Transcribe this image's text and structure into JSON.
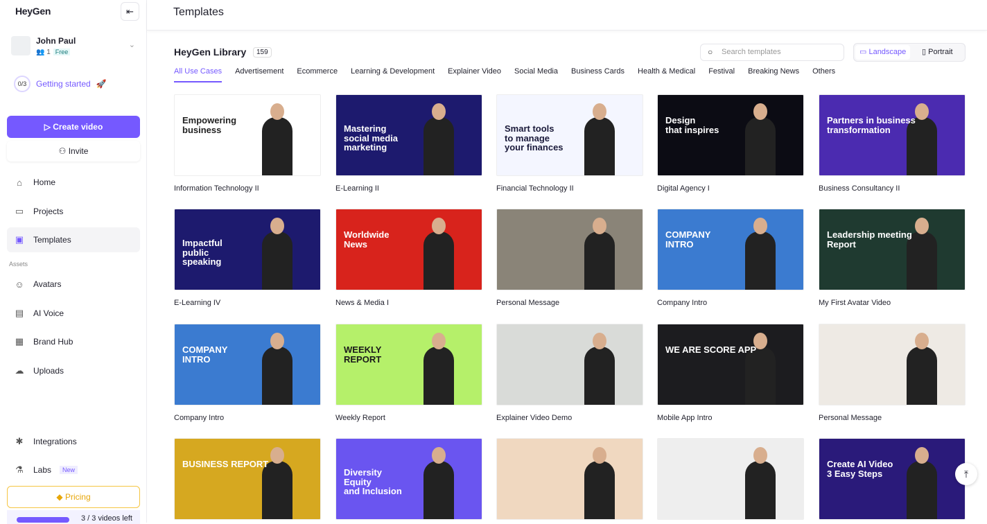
{
  "app": {
    "logo": "HeyGen",
    "page_title": "Templates"
  },
  "sidebar": {
    "user": {
      "name": "John Paul",
      "members": "1",
      "plan": "Free"
    },
    "getting_started": {
      "progress": "0/3",
      "label": "Getting started"
    },
    "create_video": "Create video",
    "invite": "Invite",
    "nav": [
      {
        "label": "Home",
        "icon": "home-icon"
      },
      {
        "label": "Projects",
        "icon": "folder-icon"
      },
      {
        "label": "Templates",
        "icon": "templates-icon",
        "active": true
      }
    ],
    "assets_label": "Assets",
    "assets": [
      {
        "label": "Avatars",
        "icon": "avatar-icon"
      },
      {
        "label": "AI Voice",
        "icon": "voice-icon"
      },
      {
        "label": "Brand Hub",
        "icon": "brand-icon"
      },
      {
        "label": "Uploads",
        "icon": "upload-icon"
      }
    ],
    "integrations": "Integrations",
    "labs": "Labs",
    "labs_badge": "New",
    "pricing": "Pricing",
    "quota": "3 / 3 videos left",
    "quota_fraction": 1.0
  },
  "library": {
    "title": "HeyGen Library",
    "count": "159",
    "search_placeholder": "Search templates",
    "landscape": "Landscape",
    "portrait": "Portrait",
    "tabs": [
      "All Use Cases",
      "Advertisement",
      "Ecommerce",
      "Learning & Development",
      "Explainer Video",
      "Social Media",
      "Business Cards",
      "Health & Medical",
      "Festival",
      "Breaking News",
      "Others"
    ],
    "templates": [
      {
        "name": "Information Technology II",
        "text": "Empowering\nbusiness",
        "bg": "#ffffff",
        "fg": "#222"
      },
      {
        "name": "E-Learning II",
        "text": "Mastering\nsocial media\nmarketing",
        "bg": "#1d1a6e",
        "fg": "#fff"
      },
      {
        "name": "Financial Technology II",
        "text": "Smart tools\nto manage\nyour finances",
        "bg": "#f4f6ff",
        "fg": "#1a1a3a"
      },
      {
        "name": "Digital Agency I",
        "text": "Design\nthat inspires",
        "bg": "#0c0c14",
        "fg": "#fff"
      },
      {
        "name": "Business Consultancy II",
        "text": "Partners in business\ntransformation",
        "bg": "#4b2bb0",
        "fg": "#fff"
      },
      {
        "name": "E-Learning IV",
        "text": "Impactful\npublic\nspeaking",
        "bg": "#1d1a6e",
        "fg": "#fff"
      },
      {
        "name": "News & Media I",
        "text": "Worldwide\nNews",
        "bg": "#d8231c",
        "fg": "#fff"
      },
      {
        "name": "Personal Message",
        "text": "",
        "bg": "#8a8478",
        "fg": "#fff"
      },
      {
        "name": "Company Intro",
        "text": "COMPANY\nINTRO",
        "bg": "#3b7bd0",
        "fg": "#fff"
      },
      {
        "name": "My First Avatar Video",
        "text": "Leadership meeting\nReport",
        "bg": "#1f3a30",
        "fg": "#fff"
      },
      {
        "name": "Company Intro",
        "text": "COMPANY\nINTRO",
        "bg": "#3b7bd0",
        "fg": "#fff"
      },
      {
        "name": "Weekly Report",
        "text": "WEEKLY\nREPORT",
        "bg": "#b5f06a",
        "fg": "#1a1a1a"
      },
      {
        "name": "Explainer Video Demo",
        "text": "",
        "bg": "#d9dbd8",
        "fg": "#fff"
      },
      {
        "name": "Mobile App Intro",
        "text": "WE ARE        SCORE APP",
        "bg": "#1c1c1f",
        "fg": "#fff"
      },
      {
        "name": "Personal Message",
        "text": "",
        "bg": "#eeeae4",
        "fg": "#fff"
      },
      {
        "name": "",
        "text": "BUSINESS REPORT",
        "bg": "#d6a820",
        "fg": "#fff"
      },
      {
        "name": "",
        "text": "Diversity\nEquity\nand Inclusion",
        "bg": "#6a55f0",
        "fg": "#fff"
      },
      {
        "name": "",
        "text": "",
        "bg": "#f0d8c0",
        "fg": "#fff"
      },
      {
        "name": "",
        "text": "",
        "bg": "#eeeeee",
        "fg": "#fff"
      },
      {
        "name": "",
        "text": "Create AI Video\n3 Easy Steps",
        "bg": "#2a1a7a",
        "fg": "#fff"
      }
    ]
  }
}
